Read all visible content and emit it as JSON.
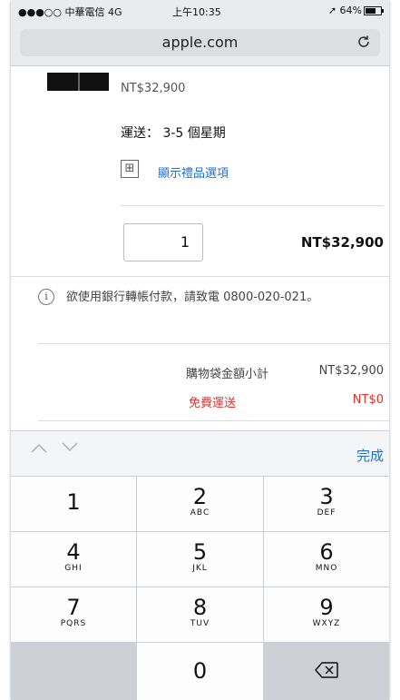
{
  "status_bar": {
    "carrier": "●●●○○ 中華電信 4G",
    "time": "上午10:35",
    "battery": "64%"
  },
  "url_bar": {
    "domain": "apple.com",
    "reload_icon": "reload-icon"
  },
  "cart": {
    "item_price": "NT$32,900",
    "shipping": "運送： 3-5 個星期",
    "gift_icon_glyph": "⊞",
    "gift_link": "顯示禮品選項",
    "quantity": "1",
    "line_total": "NT$32,900",
    "info_glyph": "i",
    "info_text": "欲使用銀行轉帳付款，請致電 0800-020-021。",
    "subtotal_label": "購物袋金額小計",
    "subtotal_value": "NT$32,900",
    "free_shipping_label": "免費運送",
    "free_shipping_value": "NT$0"
  },
  "accessory": {
    "done_label": "完成"
  },
  "keypad": {
    "k1": {
      "digit": "1",
      "letters": ""
    },
    "k2": {
      "digit": "2",
      "letters": "ABC"
    },
    "k3": {
      "digit": "3",
      "letters": "DEF"
    },
    "k4": {
      "digit": "4",
      "letters": "GHI"
    },
    "k5": {
      "digit": "5",
      "letters": "JKL"
    },
    "k6": {
      "digit": "6",
      "letters": "MNO"
    },
    "k7": {
      "digit": "7",
      "letters": "PQRS"
    },
    "k8": {
      "digit": "8",
      "letters": "TUV"
    },
    "k9": {
      "digit": "9",
      "letters": "WXYZ"
    },
    "k0": {
      "digit": "0",
      "letters": ""
    }
  },
  "colors": {
    "link": "#1d6fd1",
    "free_shipping": "#e0322b"
  }
}
